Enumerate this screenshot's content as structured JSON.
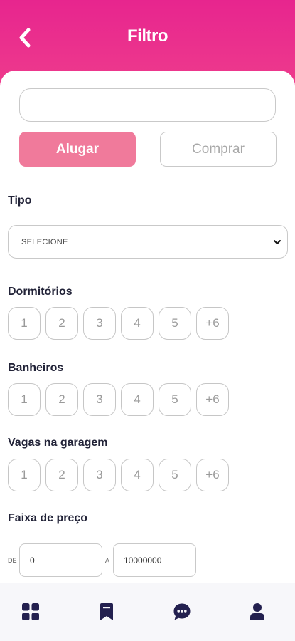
{
  "header": {
    "title": "Filtro",
    "back_icon": "chevron-left-icon",
    "gradient": [
      "#e7258e",
      "#ef3e8c"
    ]
  },
  "search": {
    "value": "",
    "placeholder": ""
  },
  "mode_toggle": {
    "options": [
      "Alugar",
      "Comprar"
    ],
    "selected": "Alugar",
    "active_color": "#f07a9b"
  },
  "tipo": {
    "label": "Tipo",
    "selected": "SELECIONE",
    "icon": "chevron-down-icon"
  },
  "dormitorios": {
    "label": "Dormitórios",
    "options": [
      "1",
      "2",
      "3",
      "4",
      "5",
      "+6"
    ]
  },
  "banheiros": {
    "label": "Banheiros",
    "options": [
      "1",
      "2",
      "3",
      "4",
      "5",
      "+6"
    ]
  },
  "vagas": {
    "label": "Vagas na garagem",
    "options": [
      "1",
      "2",
      "3",
      "4",
      "5",
      "+6"
    ]
  },
  "preco": {
    "label": "Faixa de preço",
    "from_prefix": "DE",
    "from_value": "0",
    "to_prefix": "A",
    "to_value": "10000000"
  },
  "bottom_nav": {
    "items": [
      {
        "icon": "grid-icon"
      },
      {
        "icon": "bookmark-icon"
      },
      {
        "icon": "chat-icon"
      },
      {
        "icon": "user-icon"
      }
    ],
    "icon_color": "#23204f"
  }
}
